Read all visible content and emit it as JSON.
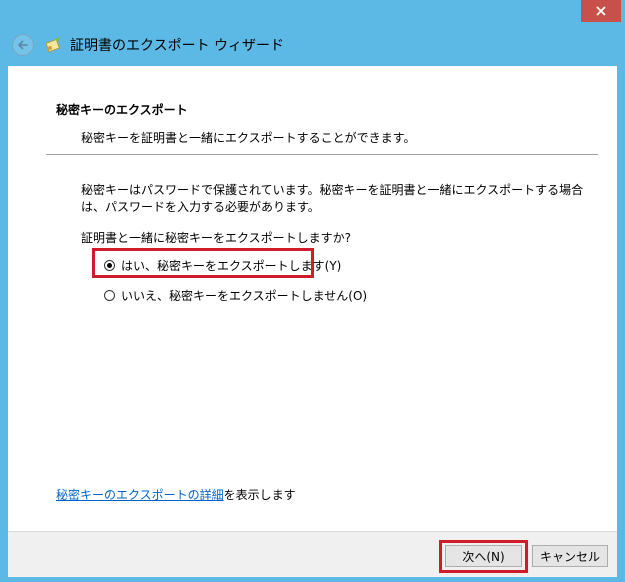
{
  "window": {
    "title": "証明書のエクスポート ウィザード",
    "close_glyph": "✕"
  },
  "page": {
    "header_title": "秘密キーのエクスポート",
    "header_subtitle": "秘密キーを証明書と一緒にエクスポートすることができます。",
    "description": "秘密キーはパスワードで保護されています。秘密キーを証明書と一緒にエクスポートする場合は、パスワードを入力する必要があります。",
    "question": "証明書と一緒に秘密キーをエクスポートしますか?",
    "options": [
      {
        "label": "はい、秘密キーをエクスポートします(Y)",
        "selected": true
      },
      {
        "label": "いいえ、秘密キーをエクスポートしません(O)",
        "selected": false
      }
    ],
    "detail_link": "秘密キーのエクスポートの詳細",
    "detail_suffix": "を表示します"
  },
  "footer": {
    "next_label": "次へ(N)",
    "cancel_label": "キャンセル"
  },
  "colors": {
    "window_frame": "#5cb9e6",
    "close_button": "#c7504a",
    "highlight": "#d01c2a",
    "link": "#0066cc"
  }
}
